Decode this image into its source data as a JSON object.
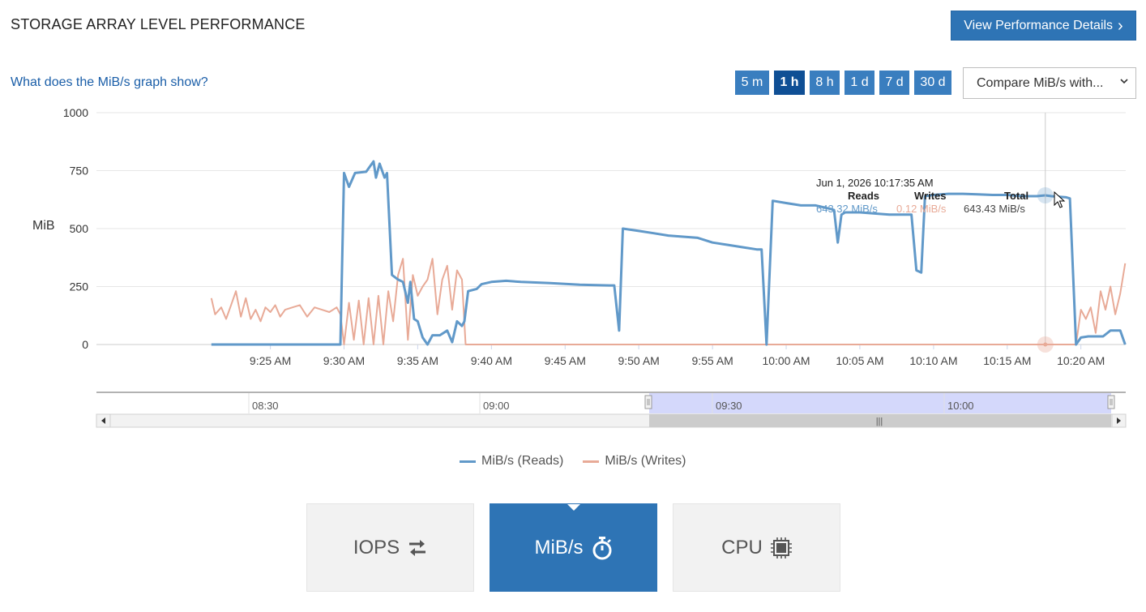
{
  "header": {
    "title": "STORAGE ARRAY LEVEL PERFORMANCE",
    "details_button": "View Performance Details",
    "details_chevron": "›"
  },
  "help_link": "What does the MiB/s graph show?",
  "time_ranges": [
    {
      "label": "5 m",
      "active": false
    },
    {
      "label": "1 h",
      "active": true
    },
    {
      "label": "8 h",
      "active": false
    },
    {
      "label": "1 d",
      "active": false
    },
    {
      "label": "7 d",
      "active": false
    },
    {
      "label": "30 d",
      "active": false
    }
  ],
  "compare_select": {
    "value": "Compare MiB/s with...",
    "chevron": "⌄"
  },
  "colors": {
    "reads": "#6199c9",
    "writes": "#e8aa97",
    "accent": "#2e74b5",
    "accent_active": "#0f4f95",
    "navigator_selection": "#d4d8fb"
  },
  "chart_data": {
    "type": "line",
    "ylabel": "MiB",
    "ylim": [
      0,
      1000
    ],
    "yticks": [
      0,
      250,
      500,
      750,
      1000
    ],
    "xlim_minutes": [
      9.22,
      10.384
    ],
    "xticks": [
      {
        "t": 9.4167,
        "label": "9:25 AM"
      },
      {
        "t": 9.5,
        "label": "9:30 AM"
      },
      {
        "t": 9.5833,
        "label": "9:35 AM"
      },
      {
        "t": 9.6667,
        "label": "9:40 AM"
      },
      {
        "t": 9.75,
        "label": "9:45 AM"
      },
      {
        "t": 9.8333,
        "label": "9:50 AM"
      },
      {
        "t": 9.9167,
        "label": "9:55 AM"
      },
      {
        "t": 10.0,
        "label": "10:00 AM"
      },
      {
        "t": 10.0833,
        "label": "10:05 AM"
      },
      {
        "t": 10.1667,
        "label": "10:10 AM"
      },
      {
        "t": 10.25,
        "label": "10:15 AM"
      },
      {
        "t": 10.3333,
        "label": "10:20 AM"
      }
    ],
    "series": [
      {
        "name": "MiB/s (Reads)",
        "color": "#6199c9",
        "points": [
          [
            "9:21",
            0
          ],
          [
            "9:29:45",
            0
          ],
          [
            "9:30:00",
            740
          ],
          [
            "9:30:20",
            680
          ],
          [
            "9:30:45",
            740
          ],
          [
            "9:31:30",
            745
          ],
          [
            "9:32:00",
            790
          ],
          [
            "9:32:10",
            720
          ],
          [
            "9:32:25",
            780
          ],
          [
            "9:32:45",
            720
          ],
          [
            "9:32:55",
            740
          ],
          [
            "9:33:15",
            300
          ],
          [
            "9:33:40",
            280
          ],
          [
            "9:34:00",
            270
          ],
          [
            "9:34:20",
            180
          ],
          [
            "9:34:30",
            270
          ],
          [
            "9:34:45",
            110
          ],
          [
            "9:35:00",
            100
          ],
          [
            "9:35:20",
            30
          ],
          [
            "9:35:40",
            0
          ],
          [
            "9:36:00",
            40
          ],
          [
            "9:36:30",
            40
          ],
          [
            "9:37:00",
            60
          ],
          [
            "9:37:20",
            10
          ],
          [
            "9:37:40",
            100
          ],
          [
            "9:38:00",
            80
          ],
          [
            "9:38:10",
            100
          ],
          [
            "9:38:25",
            230
          ],
          [
            "9:39:00",
            240
          ],
          [
            "9:39:20",
            260
          ],
          [
            "9:40:00",
            270
          ],
          [
            "9:41:00",
            275
          ],
          [
            "9:42:00",
            270
          ],
          [
            "9:44:00",
            265
          ],
          [
            "9:46:00",
            258
          ],
          [
            "9:48:00",
            255
          ],
          [
            "9:48:20",
            255
          ],
          [
            "9:48:40",
            60
          ],
          [
            "9:48:55",
            500
          ],
          [
            "9:50:00",
            490
          ],
          [
            "9:51:00",
            480
          ],
          [
            "9:52:00",
            470
          ],
          [
            "9:53:00",
            465
          ],
          [
            "9:54:00",
            460
          ],
          [
            "9:55:00",
            440
          ],
          [
            "9:56:00",
            430
          ],
          [
            "9:57:00",
            420
          ],
          [
            "9:58:00",
            410
          ],
          [
            "9:58:20",
            410
          ],
          [
            "9:58:40",
            0
          ],
          [
            "9:59:05",
            620
          ],
          [
            "10:00:00",
            610
          ],
          [
            "10:01:00",
            600
          ],
          [
            "10:02:00",
            600
          ],
          [
            "10:03:00",
            585
          ],
          [
            "10:03:15",
            580
          ],
          [
            "10:03:30",
            440
          ],
          [
            "10:03:45",
            560
          ],
          [
            "10:04:00",
            570
          ],
          [
            "10:05:00",
            570
          ],
          [
            "10:06:00",
            565
          ],
          [
            "10:07:00",
            560
          ],
          [
            "10:08:00",
            560
          ],
          [
            "10:08:30",
            560
          ],
          [
            "10:08:50",
            320
          ],
          [
            "10:09:10",
            310
          ],
          [
            "10:09:25",
            640
          ],
          [
            "10:10:00",
            645
          ],
          [
            "10:11:00",
            650
          ],
          [
            "10:12:00",
            650
          ],
          [
            "10:13:00",
            648
          ],
          [
            "10:14:00",
            645
          ],
          [
            "10:15:00",
            645
          ],
          [
            "10:16:00",
            640
          ],
          [
            "10:17:00",
            640
          ],
          [
            "10:17:35",
            643.32
          ],
          [
            "10:18:00",
            640
          ],
          [
            "10:19:00",
            635
          ],
          [
            "10:19:15",
            630
          ],
          [
            "10:19:40",
            0
          ],
          [
            "10:20:00",
            30
          ],
          [
            "10:20:30",
            35
          ],
          [
            "10:21:30",
            35
          ],
          [
            "10:22:00",
            60
          ],
          [
            "10:22:40",
            60
          ],
          [
            "10:23:00",
            0
          ]
        ]
      },
      {
        "name": "MiB/s (Writes)",
        "color": "#e8aa97",
        "points": [
          [
            "9:21",
            200
          ],
          [
            "9:21:15",
            130
          ],
          [
            "9:21:40",
            160
          ],
          [
            "9:22:00",
            110
          ],
          [
            "9:22:20",
            170
          ],
          [
            "9:22:40",
            230
          ],
          [
            "9:23:00",
            120
          ],
          [
            "9:23:20",
            200
          ],
          [
            "9:23:40",
            110
          ],
          [
            "9:24:00",
            150
          ],
          [
            "9:24:20",
            100
          ],
          [
            "9:24:40",
            160
          ],
          [
            "9:25:00",
            140
          ],
          [
            "9:25:20",
            170
          ],
          [
            "9:25:40",
            120
          ],
          [
            "9:26:00",
            150
          ],
          [
            "9:26:30",
            160
          ],
          [
            "9:27:00",
            170
          ],
          [
            "9:27:30",
            120
          ],
          [
            "9:28:00",
            160
          ],
          [
            "9:28:30",
            150
          ],
          [
            "9:29:00",
            140
          ],
          [
            "9:29:30",
            160
          ],
          [
            "9:29:45",
            130
          ],
          [
            "9:30:00",
            0
          ],
          [
            "9:30:20",
            180
          ],
          [
            "9:30:40",
            20
          ],
          [
            "9:31:00",
            190
          ],
          [
            "9:31:20",
            0
          ],
          [
            "9:31:40",
            200
          ],
          [
            "9:32:00",
            0
          ],
          [
            "9:32:20",
            210
          ],
          [
            "9:32:40",
            0
          ],
          [
            "9:33:00",
            230
          ],
          [
            "9:33:20",
            100
          ],
          [
            "9:33:40",
            300
          ],
          [
            "9:34:00",
            370
          ],
          [
            "9:34:20",
            20
          ],
          [
            "9:34:40",
            300
          ],
          [
            "9:35:00",
            210
          ],
          [
            "9:35:20",
            250
          ],
          [
            "9:35:40",
            280
          ],
          [
            "9:36:00",
            370
          ],
          [
            "9:36:20",
            130
          ],
          [
            "9:36:40",
            280
          ],
          [
            "9:37:00",
            340
          ],
          [
            "9:37:20",
            150
          ],
          [
            "9:37:40",
            320
          ],
          [
            "9:38:00",
            280
          ],
          [
            "9:38:15",
            0
          ],
          [
            "9:40:00",
            0
          ],
          [
            "9:50:00",
            0
          ],
          [
            "10:00:00",
            0
          ],
          [
            "10:10:00",
            0
          ],
          [
            "10:17:35",
            0.12
          ],
          [
            "10:19:40",
            0
          ],
          [
            "10:20:00",
            150
          ],
          [
            "10:20:20",
            110
          ],
          [
            "10:20:40",
            160
          ],
          [
            "10:21:00",
            50
          ],
          [
            "10:21:20",
            230
          ],
          [
            "10:21:40",
            150
          ],
          [
            "10:22:00",
            250
          ],
          [
            "10:22:20",
            130
          ],
          [
            "10:22:40",
            220
          ],
          [
            "10:23:00",
            350
          ]
        ]
      }
    ],
    "crosshair_time": "10:17:35",
    "tooltip": {
      "date": "Jun 1, 2026 10:17:35 AM",
      "reads_label": "Reads",
      "writes_label": "Writes",
      "total_label": "Total",
      "reads_value": "643.32 MiB/s",
      "writes_value": "0.12 MiB/s",
      "total_value": "643.43 MiB/s"
    },
    "navigator": {
      "labels": [
        "08:30",
        "09:00",
        "09:30",
        "10:00"
      ],
      "handle_glyph": "|||"
    }
  },
  "legend": [
    {
      "label": "MiB/s (Reads)",
      "color": "#6199c9"
    },
    {
      "label": "MiB/s (Writes)",
      "color": "#e8aa97"
    }
  ],
  "metric_tabs": [
    {
      "label": "IOPS",
      "icon": "swap-arrows-icon",
      "active": false
    },
    {
      "label": "MiB/s",
      "icon": "stopwatch-icon",
      "active": true
    },
    {
      "label": "CPU",
      "icon": "cpu-chip-icon",
      "active": false
    }
  ]
}
